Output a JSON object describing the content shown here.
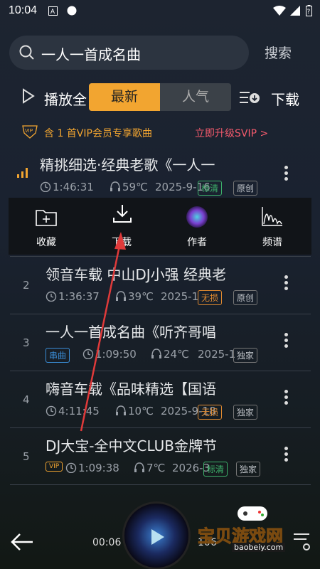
{
  "statusbar": {
    "time": "10:04"
  },
  "search": {
    "query": "一人一首成名曲",
    "button": "搜索"
  },
  "controls": {
    "play_all": "播放全",
    "tab_latest": "最新",
    "tab_popular": "人气",
    "download": "下载"
  },
  "vip": {
    "badge": "VIP",
    "notice": "含 1 首VIP会员专享歌曲",
    "upgrade": "立即升级SVIP >"
  },
  "popup_menu": [
    {
      "label": "收藏",
      "icon": "add-folder-icon"
    },
    {
      "label": "下载",
      "icon": "download-icon"
    },
    {
      "label": "作者",
      "icon": "author-avatar"
    },
    {
      "label": "频谱",
      "icon": "spectrum-icon"
    }
  ],
  "songs": [
    {
      "num": "",
      "title": "精挑细选·经典老歌《一人一",
      "duration": "1:46:31",
      "temp": "59℃",
      "date": "2025-9-16",
      "tags": [
        "标清",
        "原创"
      ]
    },
    {
      "num": "2",
      "title": "领音车载 中山DJ小强 经典老",
      "duration": "1:36:37",
      "temp": "39℃",
      "date": "2025-1",
      "tags": [
        "无损",
        "原创"
      ]
    },
    {
      "num": "3",
      "title": "一人一首成名曲《听齐哥唱",
      "prefix_tag": "串曲",
      "duration": "1:09:50",
      "temp": "24℃",
      "date": "2025-1",
      "tags": [
        "独家"
      ]
    },
    {
      "num": "4",
      "title": "嗨音车载《品味精选【国语",
      "duration": "4:11:45",
      "temp": "10℃",
      "date": "2025-9-18",
      "tags": [
        "无损",
        "独家"
      ]
    },
    {
      "num": "5",
      "title": "DJ大宝-全中文CLUB金牌节",
      "prefix_tag": "VIP",
      "duration": "1:09:38",
      "temp": "7℃",
      "date": "2026-3",
      "tags": [
        "标清",
        "独家"
      ]
    }
  ],
  "player": {
    "elapsed": "00:06",
    "total": "106"
  },
  "watermark": {
    "title": "宝贝游戏网",
    "url": "baobeiy.com"
  }
}
